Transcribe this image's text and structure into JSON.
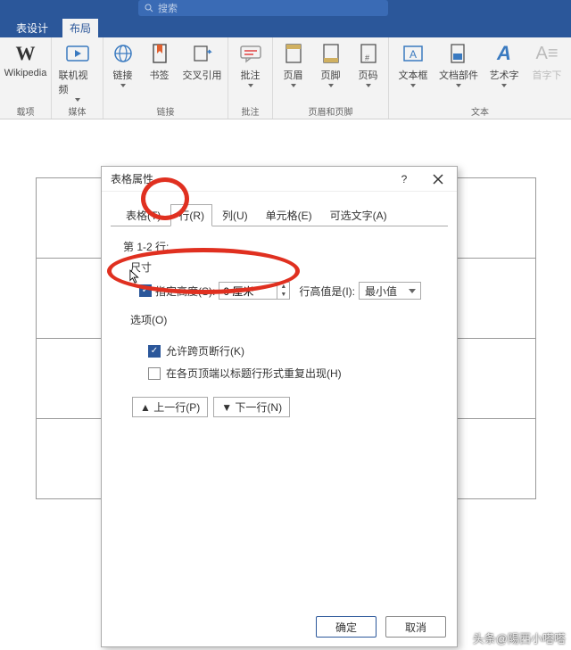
{
  "titlebar": {
    "search_placeholder": "搜索"
  },
  "tabs": {
    "design": "表设计",
    "layout": "布局"
  },
  "ribbon": {
    "wikipedia": "Wikipedia",
    "group_addons": "载项",
    "online_video": "联机视频",
    "link": "链接",
    "bookmark": "书签",
    "xref": "交叉引用",
    "comment": "批注",
    "header": "页眉",
    "footer": "页脚",
    "pagenum": "页码",
    "textbox": "文本框",
    "quickparts": "文档部件",
    "wordart": "艺术字",
    "dropcap": "首字下",
    "group_media": "媒体",
    "group_links": "链接",
    "group_comments": "批注",
    "group_hf": "页眉和页脚",
    "group_text": "文本"
  },
  "dialog": {
    "title": "表格属性",
    "tab_table": "表格(T)",
    "tab_row": "行(R)",
    "tab_col": "列(U)",
    "tab_cell": "单元格(E)",
    "tab_alt": "可选文字(A)",
    "rows_label": "第 1-2 行:",
    "size_label": "尺寸",
    "height_chk": "指定高度(S):",
    "height_value": "0 厘米",
    "measure_label": "行高值是(I):",
    "measure_value": "最小值",
    "options_label": "选项(O)",
    "opt_break": "允许跨页断行(K)",
    "opt_repeat": "在各页顶端以标题行形式重复出现(H)",
    "prev_row": "▲ 上一行(P)",
    "next_row": "▼ 下一行(N)",
    "ok": "确定",
    "cancel": "取消"
  },
  "watermark": "头条@陽西小嗒嗒"
}
